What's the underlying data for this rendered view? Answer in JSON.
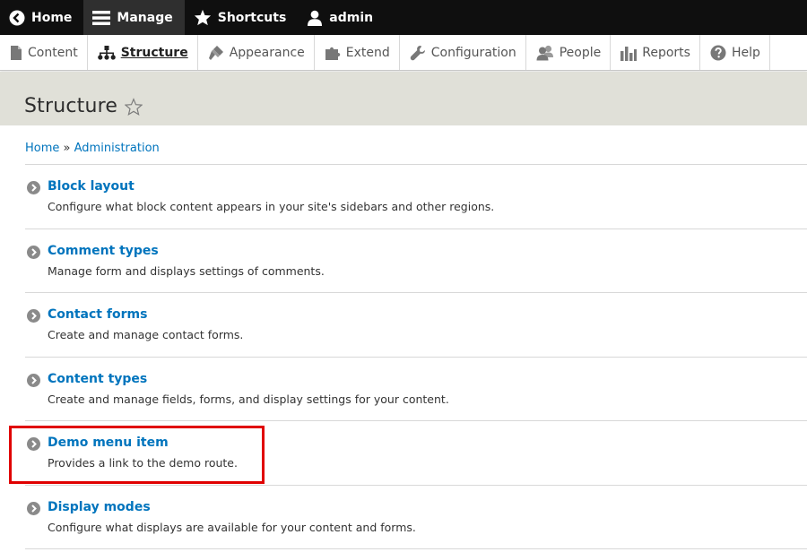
{
  "toolbar": {
    "items": [
      {
        "label": "Home",
        "icon": "back-arrow-icon"
      },
      {
        "label": "Manage",
        "icon": "hamburger-icon"
      },
      {
        "label": "Shortcuts",
        "icon": "star-icon"
      },
      {
        "label": "admin",
        "icon": "user-icon"
      }
    ]
  },
  "tray": {
    "items": [
      {
        "label": "Content",
        "icon": "file-icon"
      },
      {
        "label": "Structure",
        "icon": "sitemap-icon"
      },
      {
        "label": "Appearance",
        "icon": "paintbrush-icon"
      },
      {
        "label": "Extend",
        "icon": "puzzle-icon"
      },
      {
        "label": "Configuration",
        "icon": "wrench-icon"
      },
      {
        "label": "People",
        "icon": "people-icon"
      },
      {
        "label": "Reports",
        "icon": "bar-chart-icon"
      },
      {
        "label": "Help",
        "icon": "help-icon"
      }
    ]
  },
  "page": {
    "title": "Structure"
  },
  "breadcrumb": {
    "home": "Home",
    "separator": "»",
    "admin": "Administration"
  },
  "list": [
    {
      "title": "Block layout",
      "description": "Configure what block content appears in your site's sidebars and other regions."
    },
    {
      "title": "Comment types",
      "description": "Manage form and displays settings of comments."
    },
    {
      "title": "Contact forms",
      "description": "Create and manage contact forms."
    },
    {
      "title": "Content types",
      "description": "Create and manage fields, forms, and display settings for your content."
    },
    {
      "title": "Demo menu item",
      "description": "Provides a link to the demo route."
    },
    {
      "title": "Display modes",
      "description": "Configure what displays are available for your content and forms."
    }
  ],
  "colors": {
    "toolbar_bg": "#0f0f0f",
    "link": "#0074bd",
    "header_bg": "#e0e0d8",
    "highlight": "#e00000"
  }
}
